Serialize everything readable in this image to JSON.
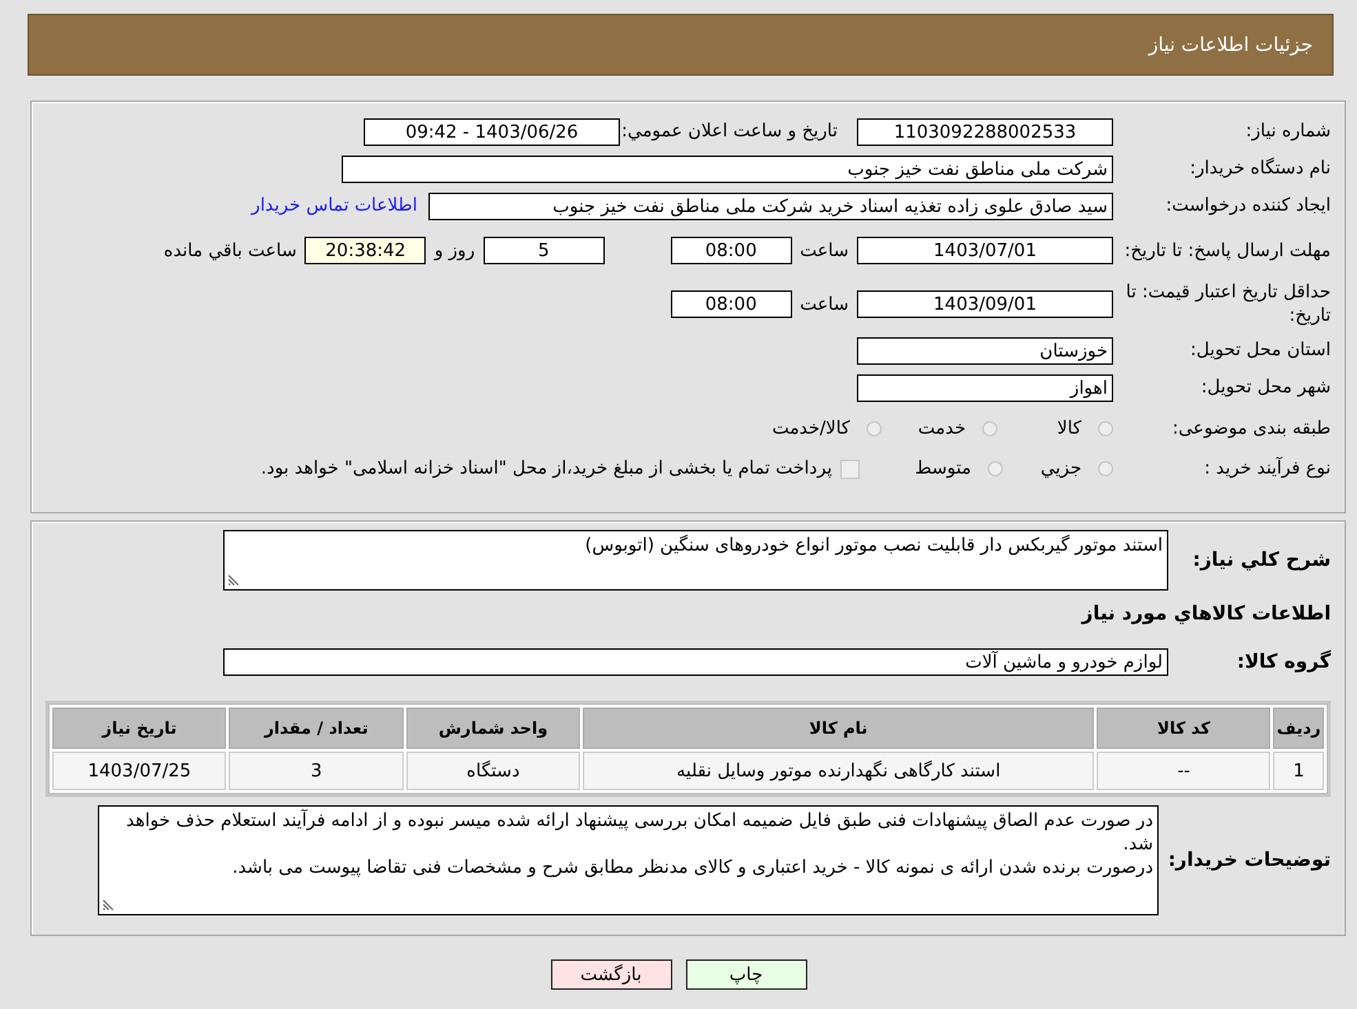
{
  "header": {
    "title": "جزئیات اطلاعات نیاز"
  },
  "details": {
    "need_number": {
      "label": "شماره نیاز:",
      "value": "1103092288002533"
    },
    "announce": {
      "label": "تاریخ و ساعت اعلان عمومي:",
      "value": "1403/06/26 - 09:42"
    },
    "buyer": {
      "label": "نام دستگاه خریدار:",
      "value": "شرکت ملی مناطق نفت خیز جنوب"
    },
    "creator": {
      "label": "ایجاد کننده درخواست:",
      "value": "سید صادق علوی زاده  تغذیه اسناد خرید  شرکت ملی مناطق نفت خیز جنوب",
      "link": "اطلاعات تماس خریدار"
    },
    "reply_deadline": {
      "label": "مهلت ارسال پاسخ: تا تاریخ:",
      "date": "1403/07/01",
      "time_label": "ساعت",
      "time": "08:00",
      "days": "5",
      "days_label": "روز و",
      "remaining": "20:38:42",
      "remaining_label": "ساعت باقي مانده"
    },
    "price_validity": {
      "label": "حداقل تاریخ اعتبار قیمت: تا تاریخ:",
      "date": "1403/09/01",
      "time_label": "ساعت",
      "time": "08:00"
    },
    "province": {
      "label": "استان محل تحویل:",
      "value": "خوزستان"
    },
    "city": {
      "label": "شهر محل تحویل:",
      "value": "اهواز"
    },
    "category": {
      "label": "طبقه بندی موضوعی:",
      "options": [
        {
          "label": "کالا",
          "selected": false
        },
        {
          "label": "خدمت",
          "selected": false
        },
        {
          "label": "کالا/خدمت",
          "selected": false
        }
      ]
    },
    "process": {
      "label": "نوع فرآیند خرید :",
      "options": [
        {
          "label": "جزيي",
          "selected": false
        },
        {
          "label": "متوسط",
          "selected": false
        }
      ],
      "payment": {
        "checked": false,
        "text": "پرداخت تمام یا بخشی از مبلغ خرید،از محل \"اسناد خزانه اسلامی\" خواهد بود."
      }
    }
  },
  "goods": {
    "description": {
      "label": "شرح كلي نیاز:",
      "value": "استند موتور گیربکس دار قابلیت نصب موتور انواع خودروهای سنگین (اتوبوس)"
    },
    "section_title": "اطلاعات كالاهاي مورد نیاز",
    "group": {
      "label": "گروه کالا:",
      "value": "لوازم خودرو و ماشین آلات"
    },
    "table": {
      "columns": [
        "ردیف",
        "کد کالا",
        "نام کالا",
        "واحد شمارش",
        "تعداد / مقدار",
        "تاریخ نیاز"
      ],
      "rows": [
        [
          "1",
          "--",
          "استند کارگاهی نگهدارنده موتور وسایل نقلیه",
          "دستگاه",
          "3",
          "1403/07/25"
        ]
      ]
    },
    "notes": {
      "label": "توضیحات خریدار:",
      "lines": [
        "در صورت عدم الصاق پیشنهادات فنی طبق فایل ضمیمه امکان بررسی پیشنهاد ارائه شده میسر نبوده و از ادامه فرآیند استعلام حذف خواهد شد.",
        "درصورت برنده شدن ارائه ی نمونه کالا - خرید اعتباری و کالای مدنظر مطابق شرح و مشخصات فنی تقاضا پیوست می باشد."
      ]
    }
  },
  "buttons": [
    {
      "label": "چاپ",
      "kind": "print"
    },
    {
      "label": "بازگشت",
      "kind": "back"
    }
  ]
}
